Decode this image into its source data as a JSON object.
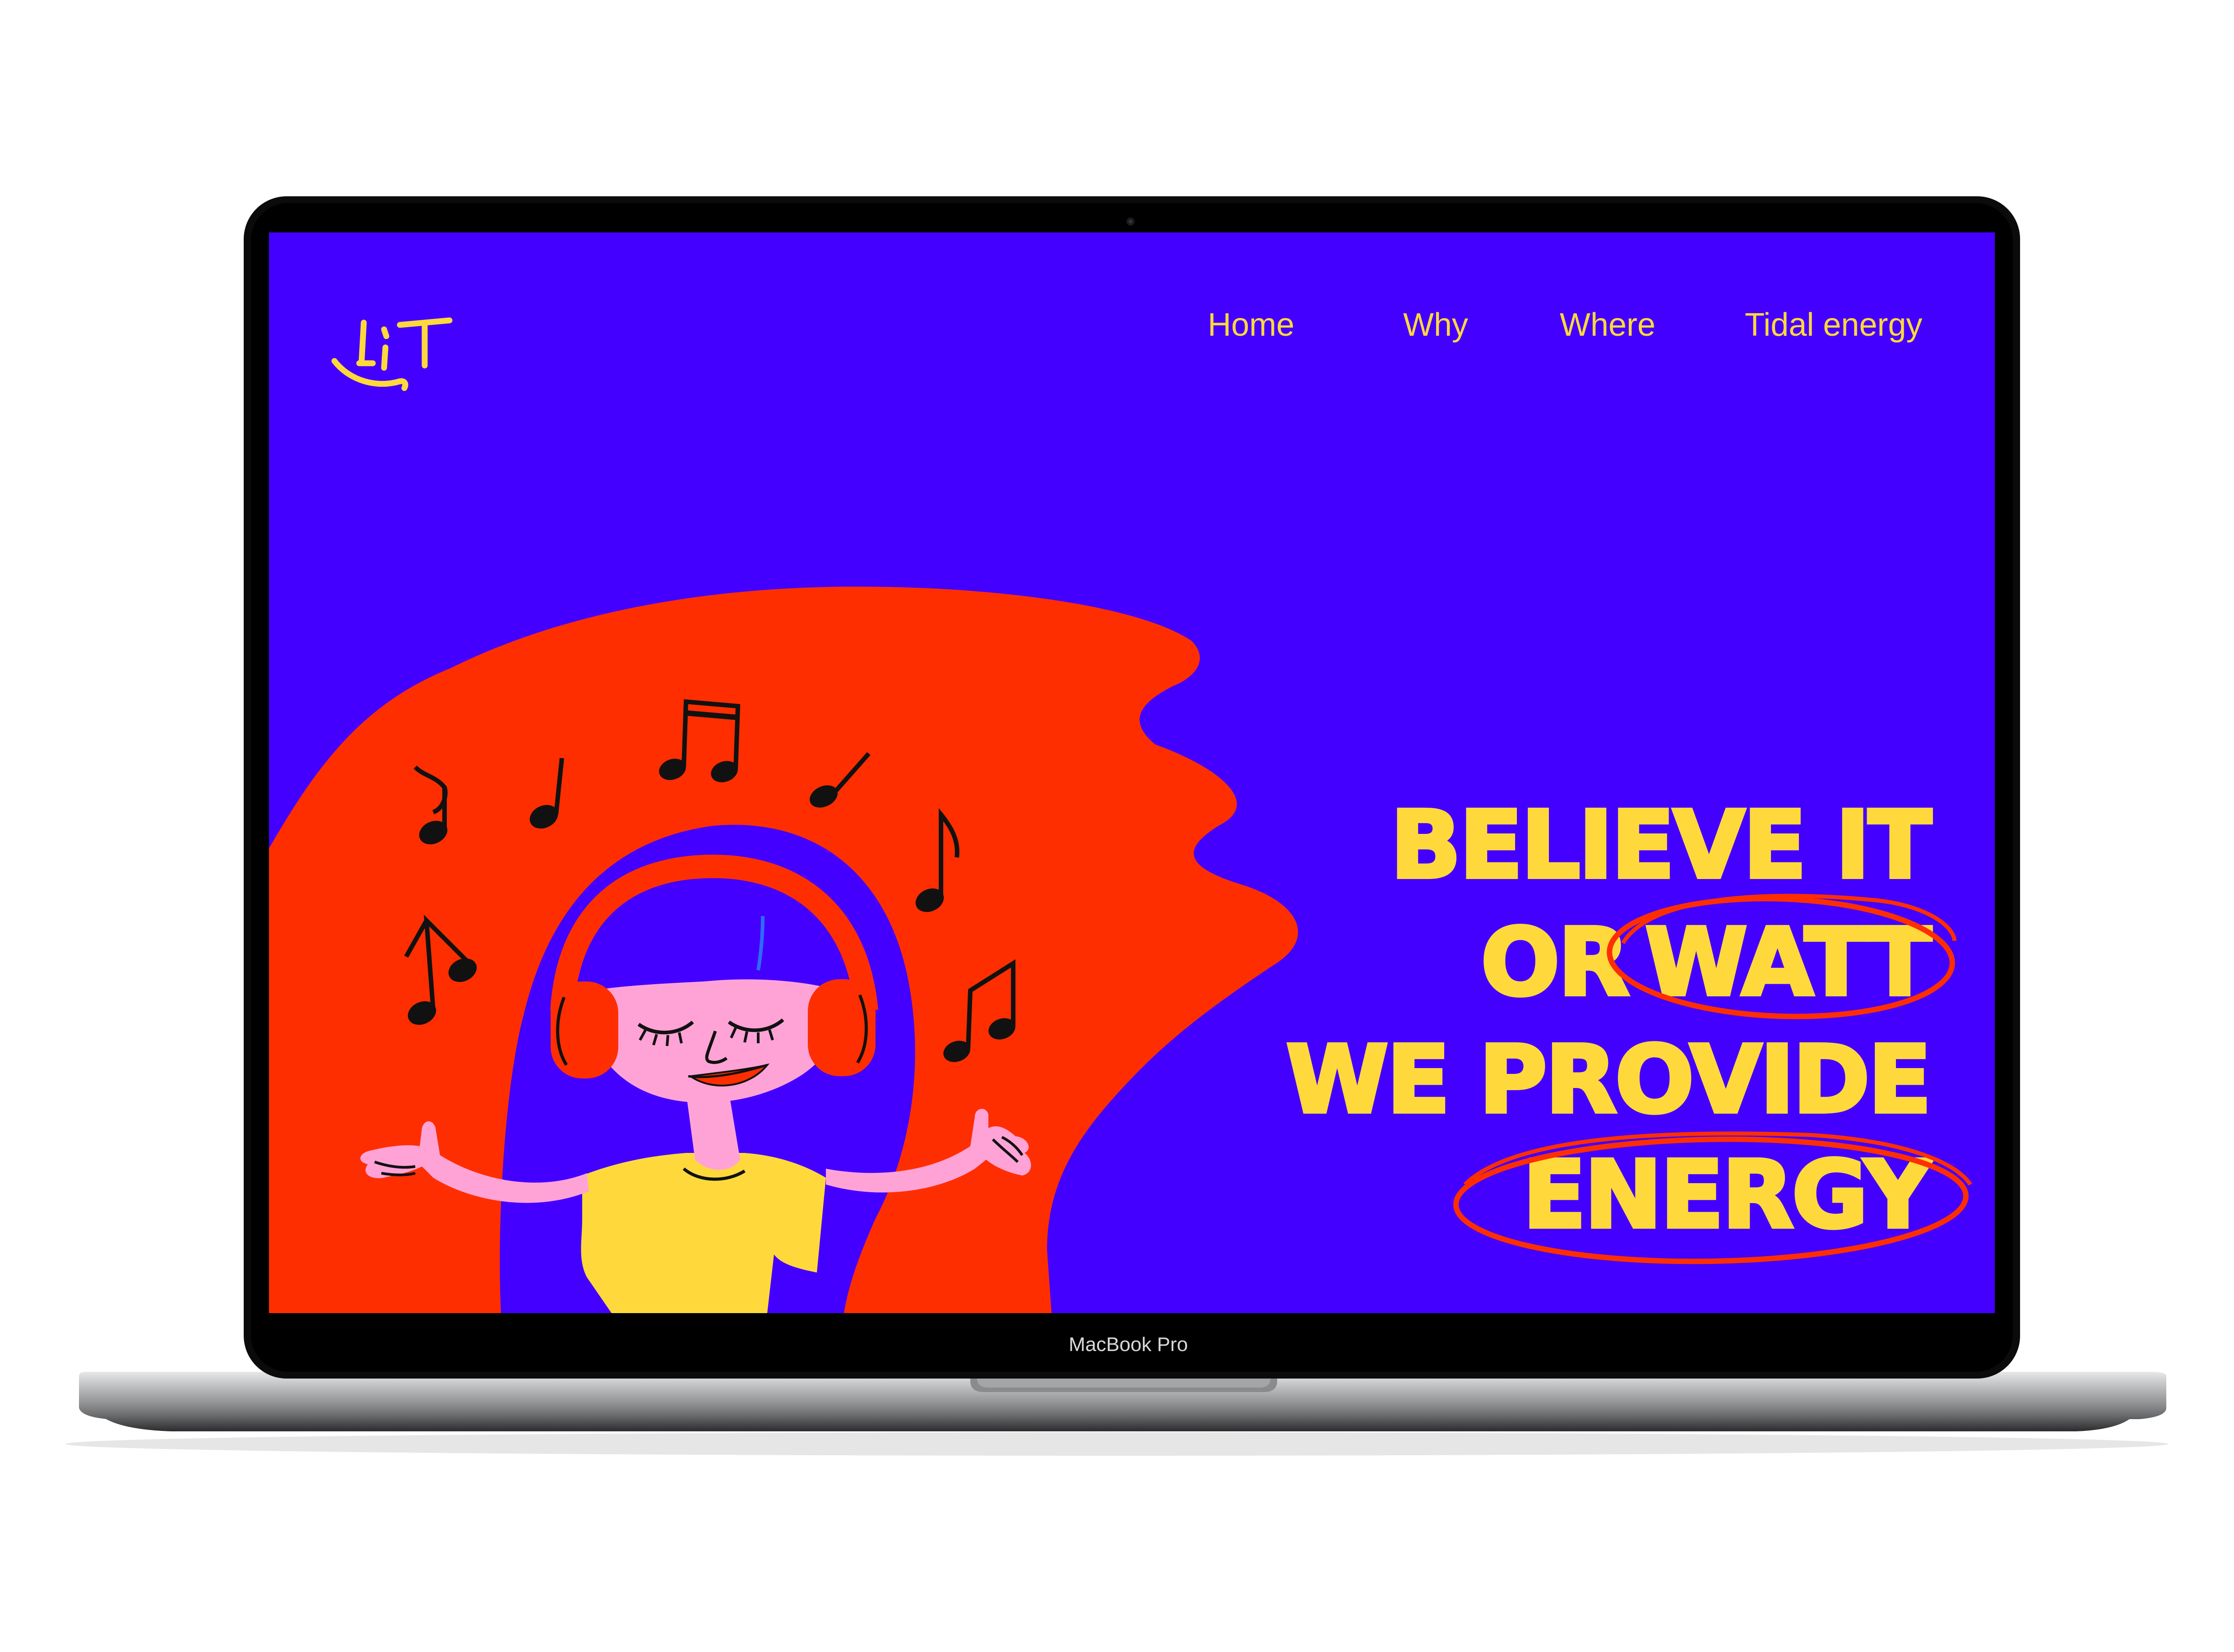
{
  "brand": {
    "logo_text": "LIT"
  },
  "nav": {
    "items": [
      {
        "label": "Home"
      },
      {
        "label": "Why"
      },
      {
        "label": "Where"
      },
      {
        "label": "Tidal energy"
      }
    ]
  },
  "hero": {
    "line1": "BELIEVE IT",
    "line2_word1": "OR",
    "line2_word2": "WATT",
    "line3": "WE PROVIDE",
    "line4": "ENERGY"
  },
  "device": {
    "label": "MacBook Pro"
  },
  "colors": {
    "background": "#4400ff",
    "accent_yellow": "#ffd93b",
    "accent_red": "#ff2e00",
    "skin": "#ffa3d7"
  },
  "icons": [
    "music-note-icon",
    "headphones-icon"
  ]
}
